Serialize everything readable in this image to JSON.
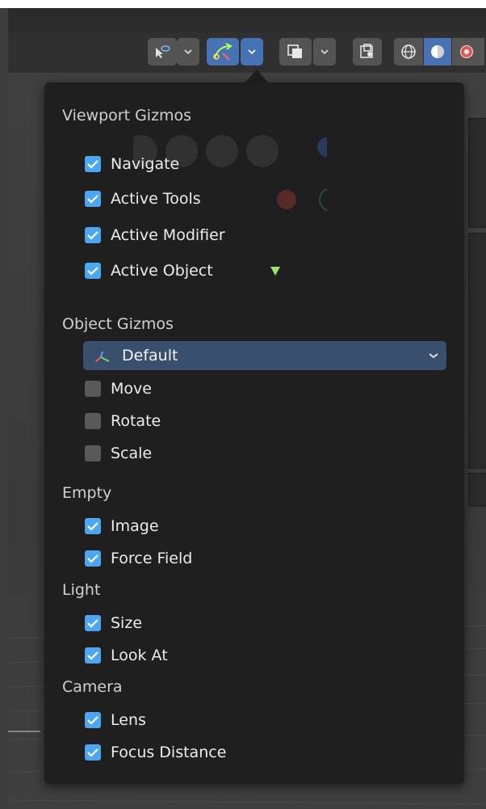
{
  "toolbar": {
    "buttons": [
      {
        "name": "selectability-visibility",
        "icon": "cursor-eye-icon",
        "active": false
      },
      {
        "name": "gizmos-toggle",
        "icon": "gizmo-arrow-icon",
        "active": true
      },
      {
        "name": "overlays-toggle",
        "icon": "overlay-squares-icon",
        "active": false
      },
      {
        "name": "xray-toggle",
        "icon": "xray-icon",
        "active": false
      },
      {
        "name": "shading-wireframe",
        "icon": "wireframe-sphere-icon",
        "active": false
      },
      {
        "name": "shading-solid",
        "icon": "solid-sphere-icon",
        "active": true
      },
      {
        "name": "shading-material",
        "icon": "material-sphere-icon",
        "active": false
      }
    ]
  },
  "popup": {
    "viewport_gizmos": {
      "title": "Viewport Gizmos",
      "items": [
        {
          "label": "Navigate",
          "checked": true
        },
        {
          "label": "Active Tools",
          "checked": true
        },
        {
          "label": "Active Modifier",
          "checked": true
        },
        {
          "label": "Active Object",
          "checked": true
        }
      ]
    },
    "object_gizmos": {
      "title": "Object Gizmos",
      "orientation": {
        "selected": "Default",
        "icon": "orientation-axes-icon"
      },
      "items": [
        {
          "label": "Move",
          "checked": false
        },
        {
          "label": "Rotate",
          "checked": false
        },
        {
          "label": "Scale",
          "checked": false
        }
      ]
    },
    "empty": {
      "title": "Empty",
      "items": [
        {
          "label": "Image",
          "checked": true
        },
        {
          "label": "Force Field",
          "checked": true
        }
      ]
    },
    "light": {
      "title": "Light",
      "items": [
        {
          "label": "Size",
          "checked": true
        },
        {
          "label": "Look At",
          "checked": true
        }
      ]
    },
    "camera": {
      "title": "Camera",
      "items": [
        {
          "label": "Lens",
          "checked": true
        },
        {
          "label": "Focus Distance",
          "checked": true
        }
      ]
    }
  },
  "colors": {
    "checkbox_on": "#4da6f0",
    "checkbox_off": "#595959",
    "popup_bg": "#1f1f1f",
    "dropdown_bg": "#3a4e6e",
    "active_button": "#4772b3",
    "marker_green": "#9be36b"
  }
}
